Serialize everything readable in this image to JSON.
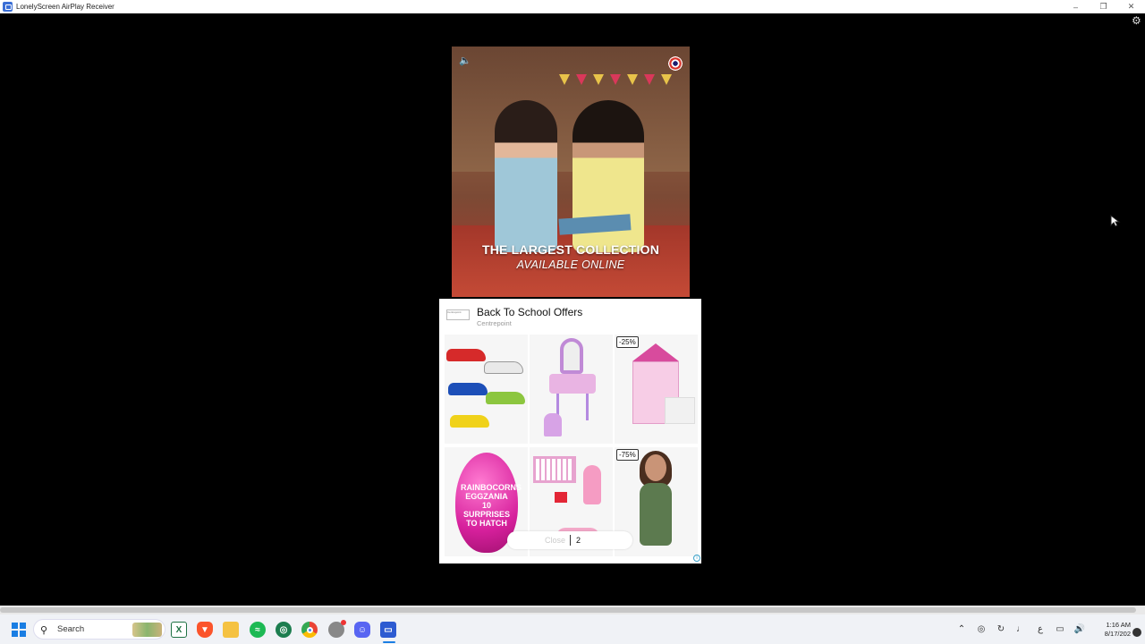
{
  "window": {
    "title": "LonelyScreen AirPlay Receiver",
    "controls": [
      "–",
      "❐",
      "✕"
    ]
  },
  "video_ad": {
    "headline": "THE LARGEST COLLECTION",
    "subheadline": "AVAILABLE ONLINE"
  },
  "offers_card": {
    "title": "Back To School Offers",
    "advertiser": "Centrepoint",
    "logo_text": "Centrepoint",
    "tiles": [
      {
        "name": "toy-cars",
        "discount": ""
      },
      {
        "name": "vanity-set",
        "discount": ""
      },
      {
        "name": "dollhouse",
        "discount": "-25%"
      },
      {
        "name": "surprise-egg",
        "discount": "",
        "text": "RAINBOCORNS EGGZANIA 10 SURPRISES TO HATCH"
      },
      {
        "name": "doll-crib-set",
        "discount": ""
      },
      {
        "name": "swimsuit",
        "discount": "-75%"
      }
    ],
    "close_label": "Close",
    "close_count": "2"
  },
  "taskbar": {
    "search_label": "Search",
    "apps": [
      "excel",
      "brave",
      "file-explorer",
      "spotify",
      "camo",
      "chrome",
      "chrome-red",
      "discord",
      "lonelyscreen"
    ],
    "clock_time": "1:16 AM",
    "clock_date": "8/17/202"
  },
  "colors": {
    "accent": "#1a7ee3",
    "stage_bg": "#000000"
  }
}
